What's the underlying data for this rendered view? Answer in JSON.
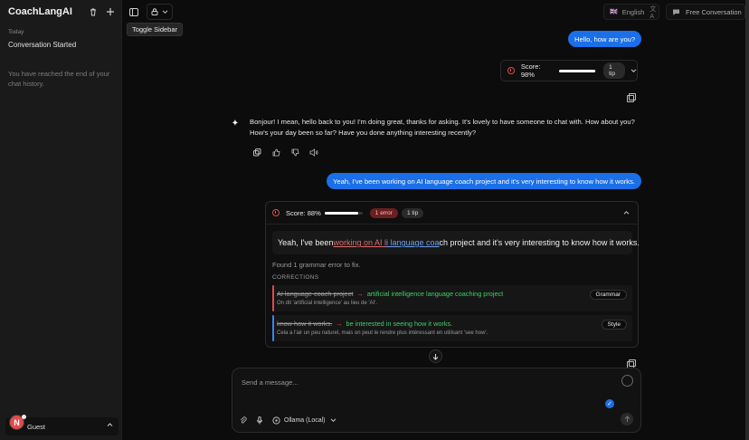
{
  "app": {
    "title": "CoachLangAI"
  },
  "sidebar": {
    "section_today": "Today",
    "items": [
      {
        "label": "Conversation Started"
      }
    ],
    "end_notice": "You have reached the end of your chat history.",
    "user": {
      "initial": "N",
      "name": "Guest"
    }
  },
  "topbar": {
    "tooltip": "Toggle Sidebar",
    "language": "English",
    "language_flag": "🇬🇧",
    "conversation_mode": "Free Conversation"
  },
  "messages": {
    "user_1": "Hello, how are you?",
    "score_1": {
      "label": "Score: 98%",
      "value": 98,
      "tips": "1 tip"
    },
    "assistant_1": "Bonjour! I mean, hello back to you! I'm doing great, thanks for asking. It's lovely to have someone to chat with. How about you? How's your day been so far? Have you done anything interesting recently?",
    "user_2": "Yeah, I've been working on AI language coach project and it's very interesting to know how it works.",
    "score_2": {
      "label": "Score: 88%",
      "value": 88,
      "errors": "1 error",
      "tips": "1 tip",
      "sentence": {
        "part1": "Yeah, I've been ",
        "err1": "working on AI l",
        "err2": "i language coa",
        "part2": "ch project and it's very interesting to know how it works."
      },
      "found": "Found 1 grammar error to fix.",
      "corrections_label": "CORRECTIONS",
      "corrections": [
        {
          "original": "AI language coach project",
          "arrow": "→",
          "fix": "artificial intelligence language coaching project",
          "note": "On dit 'artificial intelligence' au lieu de 'AI'.",
          "type": "Grammar",
          "color": "#e04a4a"
        },
        {
          "original": "know how it works.",
          "arrow": "→",
          "fix": "be interested in seeing how it works.",
          "note": "Cela a l'air un peu naturel, mais on peut le rendre plus intéressant en utilisant 'see how'.",
          "type": "Style",
          "color": "#3b82f6"
        }
      ]
    }
  },
  "composer": {
    "placeholder": "Send a message...",
    "model": "Ollama (Local)"
  },
  "colors": {
    "accent": "#1b6fe8",
    "error": "#e04a4a",
    "success": "#3fcf6a"
  }
}
